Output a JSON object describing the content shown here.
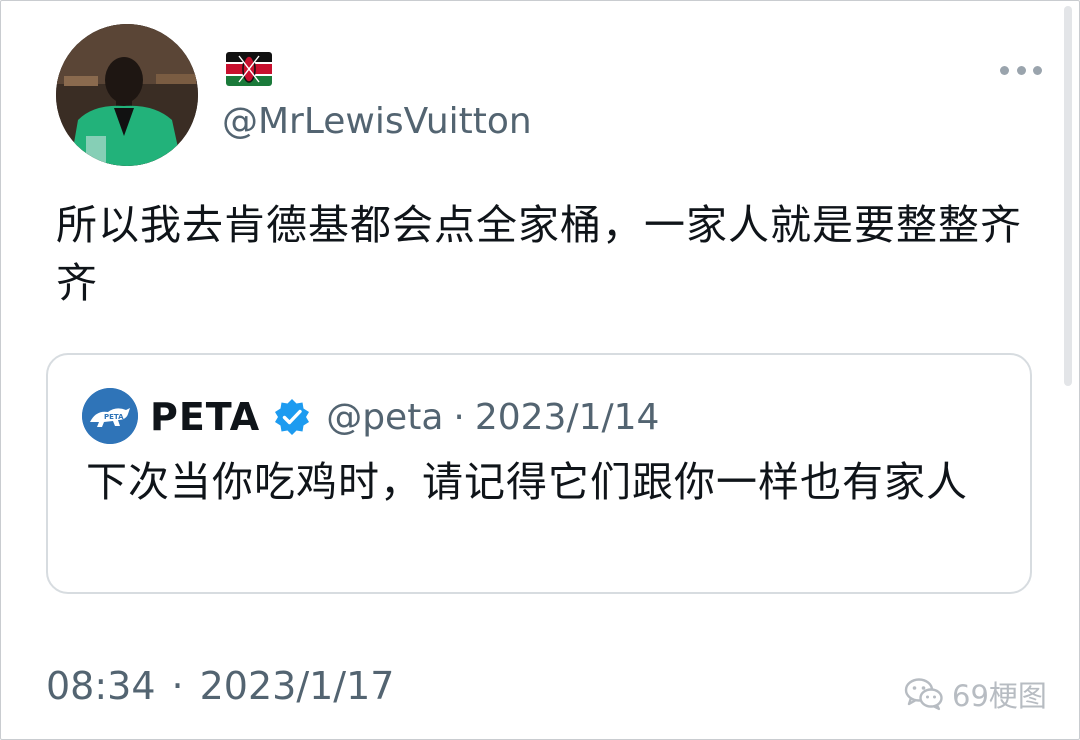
{
  "tweet": {
    "author": {
      "handle": "@MrLewisVuitton",
      "display_name_icon": "kenya-flag-emoji",
      "avatar_icon": "profile-photo"
    },
    "text": "所以我去肯德基都会点全家桶，一家人就是要整整齐齐",
    "more_icon": "more-options-icon",
    "time": "08:34",
    "separator": "·",
    "date": "2023/1/17"
  },
  "quoted_tweet": {
    "name": "PETA",
    "verified_icon": "verified-badge-icon",
    "handle": "@peta",
    "separator": "·",
    "date": "2023/1/14",
    "text": "下次当你吃鸡时，请记得它们跟你一样也有家人"
  },
  "watermark": {
    "icon": "wechat-icon",
    "text": "69梗图"
  },
  "colors": {
    "text": "#0f1419",
    "secondary": "#536471",
    "verified": "#1d9bf0",
    "peta_logo": "#2f74b8",
    "card_border": "#d7dce0"
  }
}
